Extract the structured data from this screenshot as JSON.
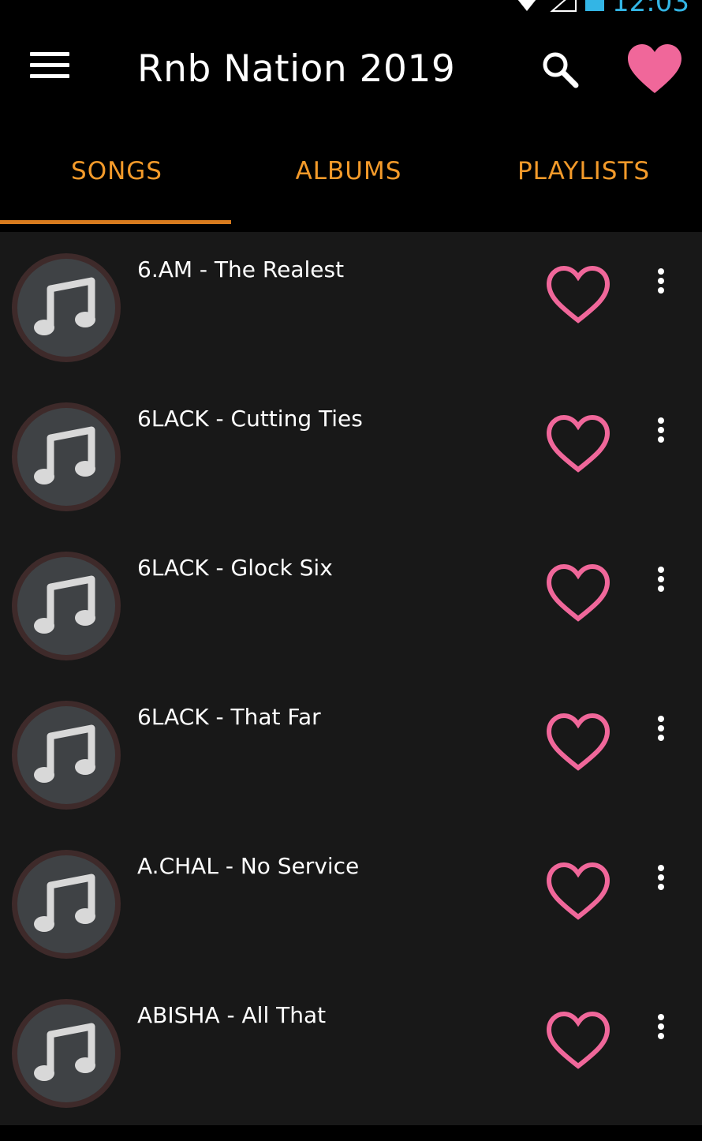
{
  "status": {
    "time": "12:03",
    "icons": [
      "wifi-icon",
      "signal-icon",
      "battery-icon"
    ],
    "time_color": "#33b5e5"
  },
  "app_bar": {
    "title": "Rnb Nation 2019",
    "menu_icon": "hamburger-menu-icon",
    "search_icon": "search-icon",
    "favorites_icon": "heart-filled-icon"
  },
  "tabs": [
    {
      "label": "SONGS",
      "active": true
    },
    {
      "label": "ALBUMS",
      "active": false
    },
    {
      "label": "PLAYLISTS",
      "active": false
    }
  ],
  "songs": [
    {
      "title": "6.AM - The Realest"
    },
    {
      "title": "6LACK - Cutting Ties"
    },
    {
      "title": "6LACK - Glock Six"
    },
    {
      "title": "6LACK - That Far"
    },
    {
      "title": "A.CHAL - No Service"
    },
    {
      "title": "ABISHA - All That"
    }
  ],
  "colors": {
    "accent": "#f39a2a",
    "heart": "#f0679a",
    "background": "#181818"
  }
}
